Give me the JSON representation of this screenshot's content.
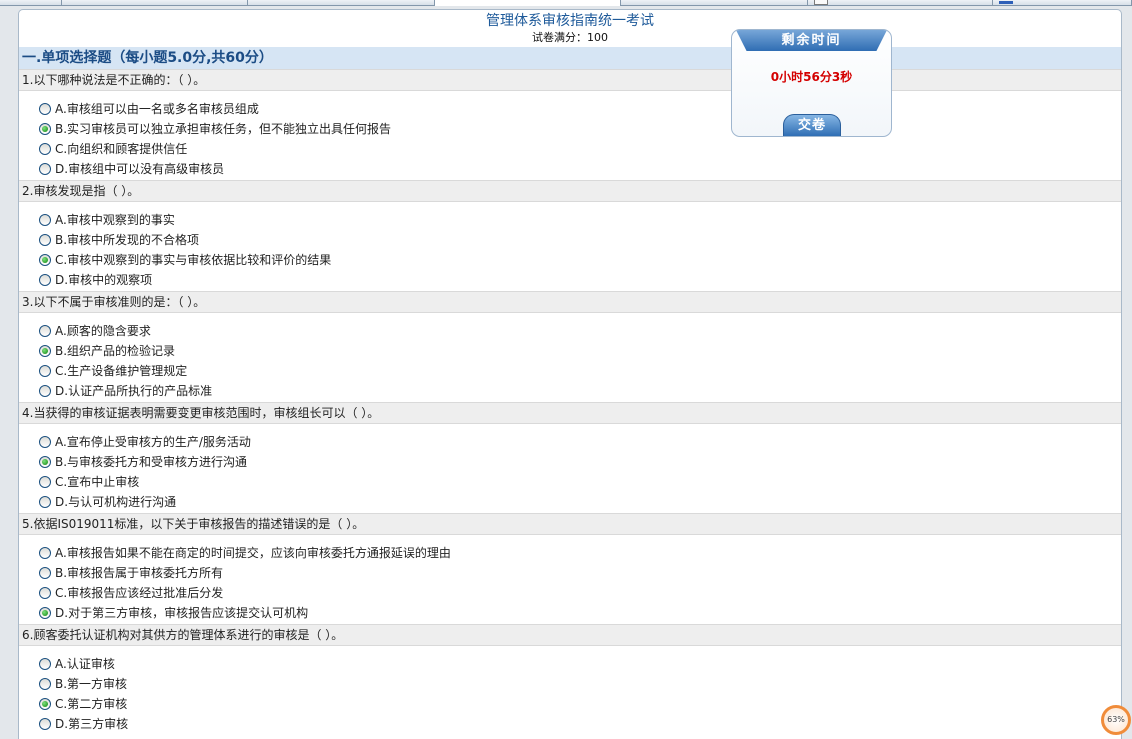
{
  "browser_tabs": {
    "icons": [
      "document-icon",
      "blue-page-icon"
    ]
  },
  "exam": {
    "title": "管理体系审核指南统一考试",
    "full_score": "试卷满分：100"
  },
  "section": {
    "title": "一.单项选择题（每小题5.0分,共60分）"
  },
  "questions": [
    {
      "text": "1.以下哪种说法是不正确的：（ ）。",
      "options": [
        {
          "label": "A.",
          "text": "审核组可以由一名或多名审核员组成",
          "selected": false
        },
        {
          "label": "B.",
          "text": "实习审核员可以独立承担审核任务，但不能独立出具任何报告",
          "selected": true
        },
        {
          "label": "C.",
          "text": "向组织和顾客提供信任",
          "selected": false
        },
        {
          "label": "D.",
          "text": "审核组中可以没有高级审核员",
          "selected": false
        }
      ]
    },
    {
      "text": "2.审核发现是指（ ）。",
      "options": [
        {
          "label": "A.",
          "text": "审核中观察到的事实",
          "selected": false
        },
        {
          "label": "B.",
          "text": "审核中所发现的不合格项",
          "selected": false
        },
        {
          "label": "C.",
          "text": "审核中观察到的事实与审核依据比较和评价的结果",
          "selected": true
        },
        {
          "label": "D.",
          "text": "审核中的观察项",
          "selected": false
        }
      ]
    },
    {
      "text": "3.以下不属于审核准则的是：（ ）。",
      "options": [
        {
          "label": "A.",
          "text": "顾客的隐含要求",
          "selected": false
        },
        {
          "label": "B.",
          "text": "组织产品的检验记录",
          "selected": true
        },
        {
          "label": "C.",
          "text": "生产设备维护管理规定",
          "selected": false
        },
        {
          "label": "D.",
          "text": "认证产品所执行的产品标准",
          "selected": false
        }
      ]
    },
    {
      "text": "4.当获得的审核证据表明需要变更审核范围时，审核组长可以（ ）。",
      "options": [
        {
          "label": "A.",
          "text": "宣布停止受审核方的生产/服务活动",
          "selected": false
        },
        {
          "label": "B.",
          "text": "与审核委托方和受审核方进行沟通",
          "selected": true
        },
        {
          "label": "C.",
          "text": "宣布中止审核",
          "selected": false
        },
        {
          "label": "D.",
          "text": "与认可机构进行沟通",
          "selected": false
        }
      ]
    },
    {
      "text": "5.依据IS019011标准，以下关于审核报告的描述错误的是（ ）。",
      "options": [
        {
          "label": "A.",
          "text": "审核报告如果不能在商定的时间提交，应该向审核委托方通报延误的理由",
          "selected": false
        },
        {
          "label": "B.",
          "text": "审核报告属于审核委托方所有",
          "selected": false
        },
        {
          "label": "C.",
          "text": "审核报告应该经过批准后分发",
          "selected": false
        },
        {
          "label": "D.",
          "text": "对于第三方审核，审核报告应该提交认可机构",
          "selected": true
        }
      ]
    },
    {
      "text": "6.顾客委托认证机构对其供方的管理体系进行的审核是（ ）。",
      "options": [
        {
          "label": "A.",
          "text": "认证审核",
          "selected": false
        },
        {
          "label": "B.",
          "text": "第一方审核",
          "selected": false
        },
        {
          "label": "C.",
          "text": "第二方审核",
          "selected": true
        },
        {
          "label": "D.",
          "text": "第三方审核",
          "selected": false
        }
      ]
    }
  ],
  "timer": {
    "header": "剩余时间",
    "remaining": "0小时56分3秒",
    "submit_label": "交卷"
  },
  "zoom_badge": {
    "value": "63%"
  },
  "colors": {
    "title": "#1e5a9a",
    "section_bg": "#d6e5f4",
    "section_text": "#1b4c85",
    "timer_text": "#d40000",
    "radio_selected": "#2ea12e",
    "badge": "#f08c3a"
  }
}
